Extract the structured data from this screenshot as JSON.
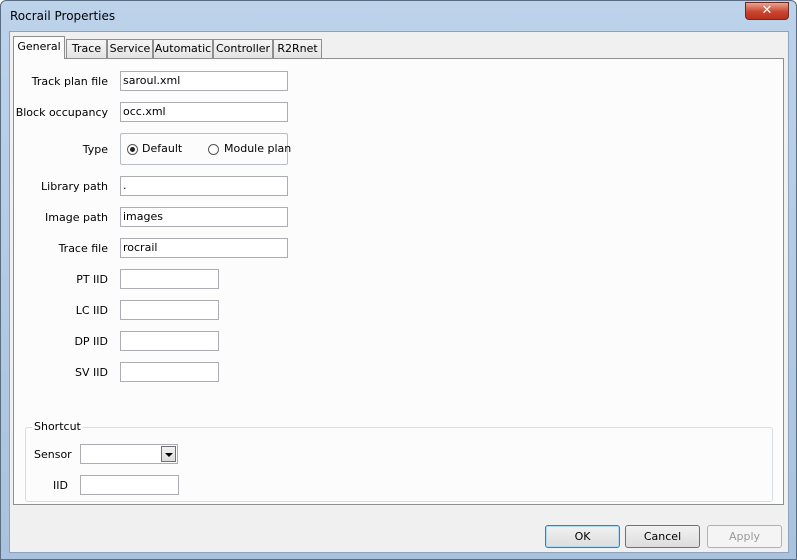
{
  "window": {
    "title": "Rocrail Properties",
    "close_label": "✕"
  },
  "tabs": [
    {
      "label": "General",
      "active": true
    },
    {
      "label": "Trace"
    },
    {
      "label": "Service"
    },
    {
      "label": "Automatic"
    },
    {
      "label": "Controller"
    },
    {
      "label": "R2Rnet"
    }
  ],
  "general": {
    "track_plan_file": {
      "label": "Track plan file",
      "value": "saroul.xml"
    },
    "block_occupancy": {
      "label": "Block occupancy",
      "value": "occ.xml"
    },
    "type": {
      "label": "Type",
      "options": [
        {
          "label": "Default",
          "checked": true
        },
        {
          "label": "Module plan",
          "checked": false
        }
      ]
    },
    "library_path": {
      "label": "Library path",
      "value": "."
    },
    "image_path": {
      "label": "Image path",
      "value": "images"
    },
    "trace_file": {
      "label": "Trace file",
      "value": "rocrail"
    },
    "pt_iid": {
      "label": "PT IID",
      "value": ""
    },
    "lc_iid": {
      "label": "LC IID",
      "value": ""
    },
    "dp_iid": {
      "label": "DP IID",
      "value": ""
    },
    "sv_iid": {
      "label": "SV IID",
      "value": ""
    }
  },
  "shortcut": {
    "title": "Shortcut",
    "sensor": {
      "label": "Sensor",
      "value": ""
    },
    "iid": {
      "label": "IID",
      "value": ""
    }
  },
  "buttons": {
    "ok": "OK",
    "cancel": "Cancel",
    "apply": "Apply"
  }
}
